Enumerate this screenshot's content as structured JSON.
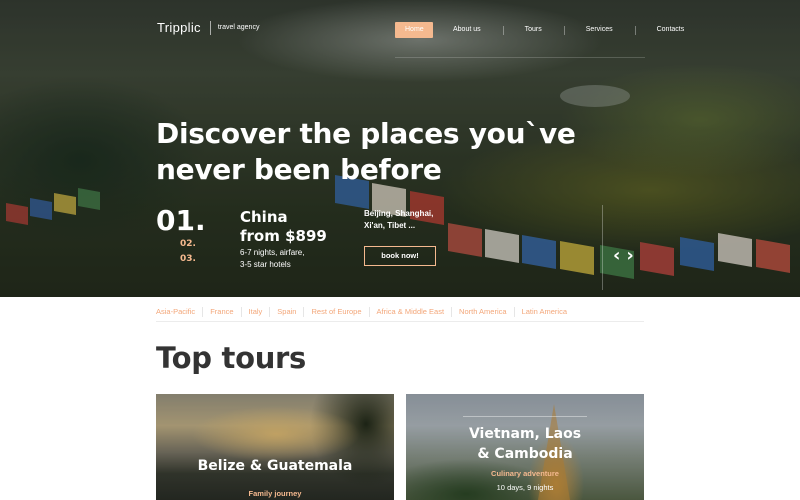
{
  "brand": {
    "logo": "Tripplic",
    "tagline": "travel agency"
  },
  "nav": {
    "items": [
      {
        "label": "Home",
        "active": true
      },
      {
        "label": "About us",
        "active": false
      },
      {
        "label": "Tours",
        "active": false
      },
      {
        "label": "Services",
        "active": false
      },
      {
        "label": "Contacts",
        "active": false
      }
    ]
  },
  "hero": {
    "headline_line1": "Discover the places you`ve",
    "headline_line2": "never been before",
    "slide_current": "01.",
    "slide_2": "02.",
    "slide_3": "03.",
    "destination": "China",
    "price": "from $899",
    "desc_line1": "6-7 nights, airfare,",
    "desc_line2": "3-5 star hotels",
    "cities_line1": "Beijing, Shanghai,",
    "cities_line2": "Xi'an, Tibet ...",
    "book_label": "book now!",
    "prev_icon": "‹",
    "next_icon": "›"
  },
  "regions": [
    "Asia-Pacific",
    "France",
    "Italy",
    "Spain",
    "Rest of Europe",
    "Africa & Middle East",
    "North America",
    "Latin America"
  ],
  "section_title": "Top tours",
  "cards": [
    {
      "title": "Belize & Guatemala",
      "subtitle": "Family journey"
    },
    {
      "title_line1": "Vietnam, Laos",
      "title_line2": "& Cambodia",
      "subtitle": "Culinary adventure",
      "meta": "10 days, 9 nights"
    }
  ],
  "colors": {
    "accent": "#f5b98f",
    "region_link": "#f3a77a",
    "text_dark": "#333333"
  }
}
